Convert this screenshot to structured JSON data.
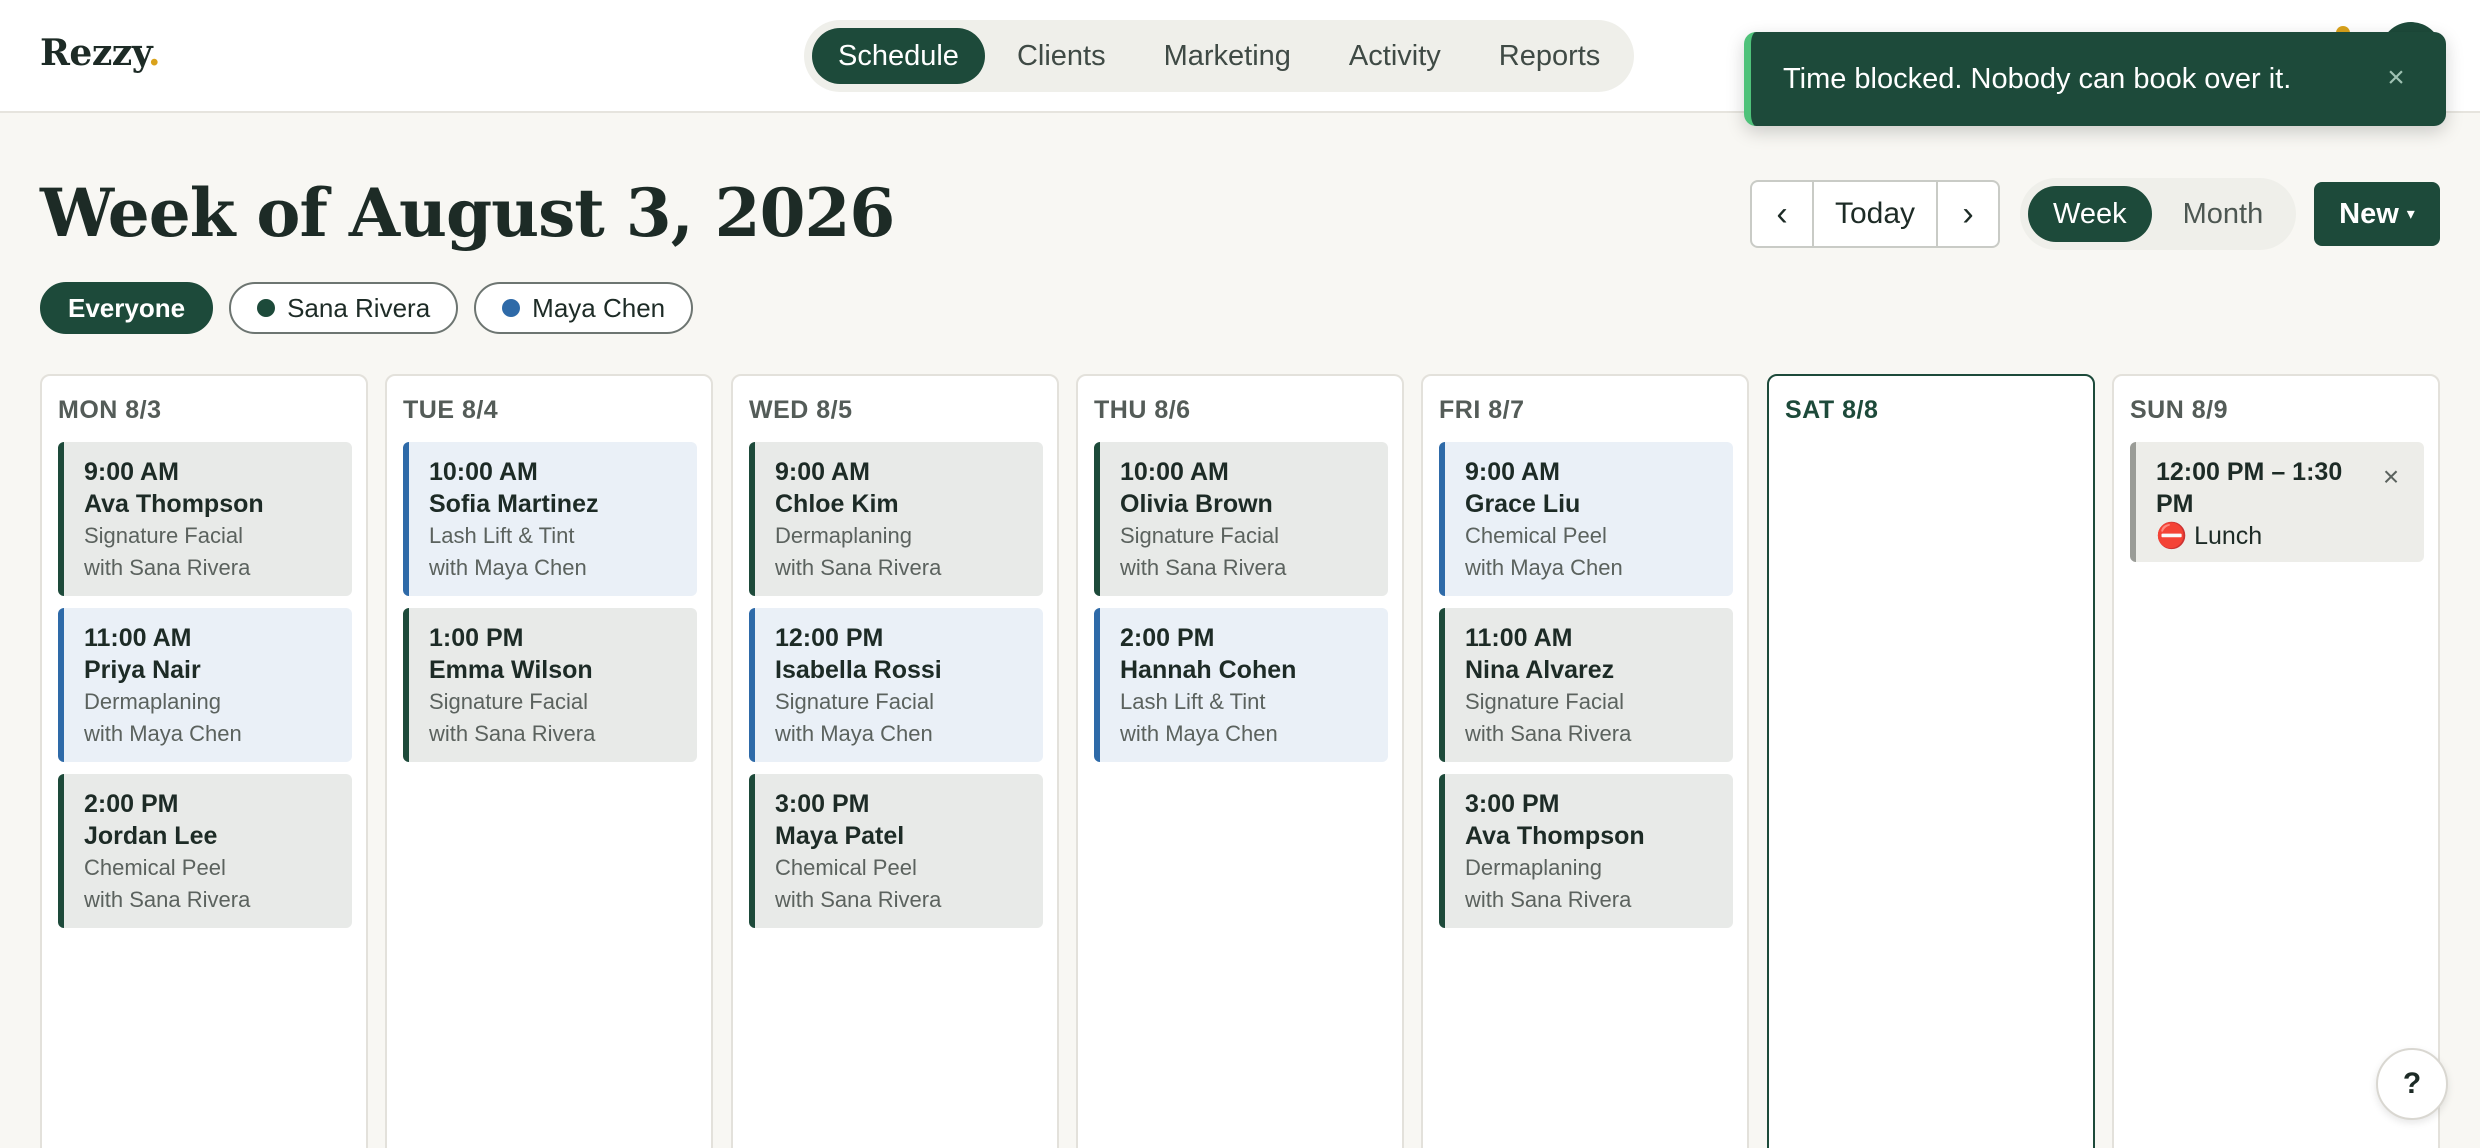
{
  "app": {
    "logo_text": "Rezzy",
    "logo_dot": ".",
    "logo_dot_color": "#d9a21b",
    "brand_color": "#1d4a3a"
  },
  "nav": {
    "tabs": [
      {
        "label": "Schedule",
        "active": true
      },
      {
        "label": "Clients",
        "active": false
      },
      {
        "label": "Marketing",
        "active": false
      },
      {
        "label": "Activity",
        "active": false
      },
      {
        "label": "Reports",
        "active": false
      }
    ]
  },
  "toast": {
    "message": "Time blocked. Nobody can book over it.",
    "close_icon": "×",
    "accent_color": "#4fc27a"
  },
  "header": {
    "title": "Week of August 3, 2026",
    "prev_label": "‹",
    "today_label": "Today",
    "next_label": "›",
    "view_week": "Week",
    "view_month": "Month",
    "active_view": "Week",
    "new_label": "New",
    "new_caret": "▾"
  },
  "filters": [
    {
      "label": "Everyone",
      "active": true,
      "dot_color": null
    },
    {
      "label": "Sana Rivera",
      "active": false,
      "dot_color": "#1d4a3a"
    },
    {
      "label": "Maya Chen",
      "active": false,
      "dot_color": "#2e6aa8"
    }
  ],
  "days": [
    {
      "label": "MON 8/3",
      "today": false,
      "appointments": [
        {
          "time": "9:00 AM",
          "client": "Ava Thompson",
          "service": "Signature Facial",
          "staff": "with Sana Rivera",
          "provider": "sana"
        },
        {
          "time": "11:00 AM",
          "client": "Priya Nair",
          "service": "Dermaplaning",
          "staff": "with Maya Chen",
          "provider": "maya"
        },
        {
          "time": "2:00 PM",
          "client": "Jordan Lee",
          "service": "Chemical Peel",
          "staff": "with Sana Rivera",
          "provider": "sana"
        }
      ]
    },
    {
      "label": "TUE 8/4",
      "today": false,
      "appointments": [
        {
          "time": "10:00 AM",
          "client": "Sofia Martinez",
          "service": "Lash Lift & Tint",
          "staff": "with Maya Chen",
          "provider": "maya"
        },
        {
          "time": "1:00 PM",
          "client": "Emma Wilson",
          "service": "Signature Facial",
          "staff": "with Sana Rivera",
          "provider": "sana"
        }
      ]
    },
    {
      "label": "WED 8/5",
      "today": false,
      "appointments": [
        {
          "time": "9:00 AM",
          "client": "Chloe Kim",
          "service": "Dermaplaning",
          "staff": "with Sana Rivera",
          "provider": "sana"
        },
        {
          "time": "12:00 PM",
          "client": "Isabella Rossi",
          "service": "Signature Facial",
          "staff": "with Maya Chen",
          "provider": "maya"
        },
        {
          "time": "3:00 PM",
          "client": "Maya Patel",
          "service": "Chemical Peel",
          "staff": "with Sana Rivera",
          "provider": "sana"
        }
      ]
    },
    {
      "label": "THU 8/6",
      "today": false,
      "appointments": [
        {
          "time": "10:00 AM",
          "client": "Olivia Brown",
          "service": "Signature Facial",
          "staff": "with Sana Rivera",
          "provider": "sana"
        },
        {
          "time": "2:00 PM",
          "client": "Hannah Cohen",
          "service": "Lash Lift & Tint",
          "staff": "with Maya Chen",
          "provider": "maya"
        }
      ]
    },
    {
      "label": "FRI 8/7",
      "today": false,
      "appointments": [
        {
          "time": "9:00 AM",
          "client": "Grace Liu",
          "service": "Chemical Peel",
          "staff": "with Maya Chen",
          "provider": "maya"
        },
        {
          "time": "11:00 AM",
          "client": "Nina Alvarez",
          "service": "Signature Facial",
          "staff": "with Sana Rivera",
          "provider": "sana"
        },
        {
          "time": "3:00 PM",
          "client": "Ava Thompson",
          "service": "Dermaplaning",
          "staff": "with Sana Rivera",
          "provider": "sana"
        }
      ]
    },
    {
      "label": "SAT 8/8",
      "today": true,
      "appointments": []
    },
    {
      "label": "SUN 8/9",
      "today": false,
      "blocks": [
        {
          "time": "12:00 PM – 1:30 PM",
          "label": "⛔ Lunch",
          "close_icon": "×"
        }
      ]
    }
  ],
  "help": {
    "label": "?"
  }
}
